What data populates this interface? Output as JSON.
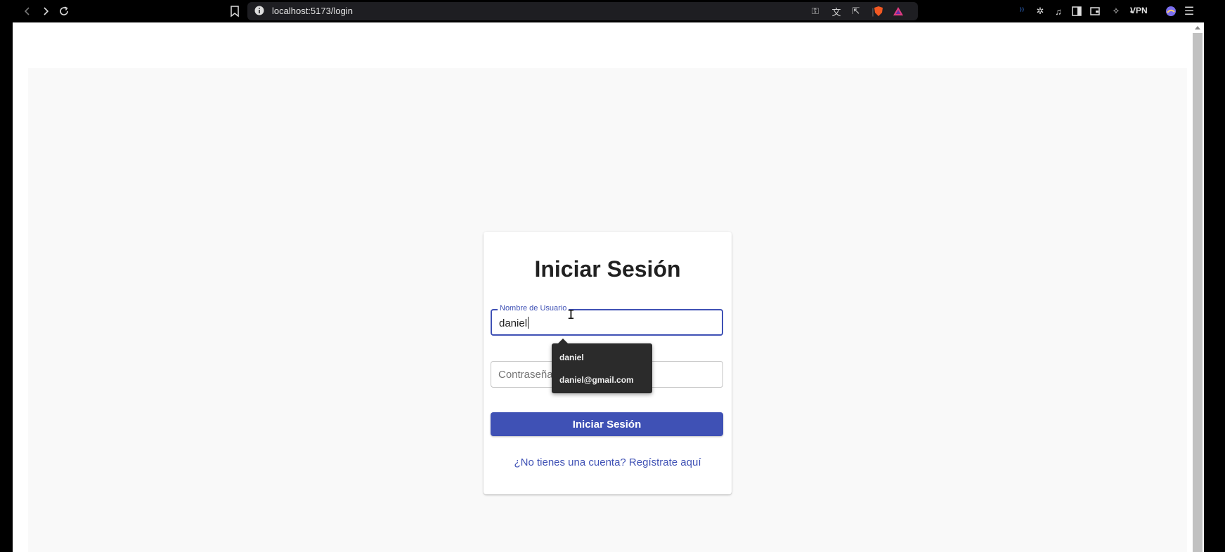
{
  "browser": {
    "url": "localhost:5173/login",
    "vpn_label": "VPN"
  },
  "login": {
    "title": "Iniciar Sesión",
    "username_label": "Nombre de Usuario",
    "username_value": "daniel",
    "password_placeholder": "Contraseña",
    "submit_label": "Iniciar Sesión",
    "register_link": "¿No tienes una cuenta? Regístrate aquí"
  },
  "autocomplete": {
    "items": [
      "daniel",
      "daniel@gmail.com"
    ]
  },
  "colors": {
    "primary": "#3f51b5",
    "chrome_bg": "#000000",
    "page_bg": "#f9f9f9"
  }
}
